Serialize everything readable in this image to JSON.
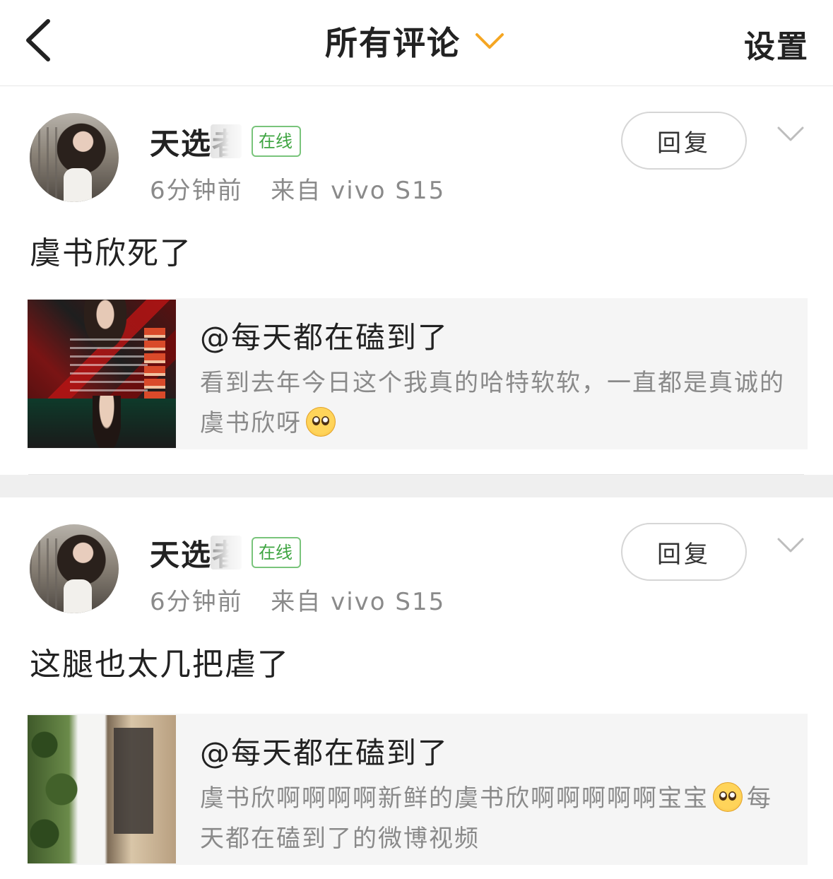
{
  "header": {
    "title": "所有评论",
    "settings_label": "设置"
  },
  "comments": [
    {
      "username": "天选者",
      "online_badge": "在线",
      "time": "6分钟前",
      "source": "来自 vivo S15",
      "reply_label": "回复",
      "text": "虞书欣死了",
      "quote": {
        "user": "@每天都在磕到了",
        "line1": "看到去年今日这个我真的哈特软软，一直都是真诚的",
        "line2_before": "虞书欣呀",
        "line2_after": ""
      }
    },
    {
      "username": "天选者",
      "online_badge": "在线",
      "time": "6分钟前",
      "source": "来自 vivo S15",
      "reply_label": "回复",
      "text": "这腿也太几把虐了",
      "quote": {
        "user": "@每天都在磕到了",
        "line1_before": "虞书欣啊啊啊啊新鲜的虞书欣啊啊啊啊啊宝宝",
        "line1_after": "每",
        "line2": "天都在磕到了的微博视频"
      }
    }
  ],
  "icons": {
    "back": "chevron-left-icon",
    "title_dropdown": "chevron-down-icon",
    "comment_menu": "chevron-down-icon",
    "emoji": "pleading-face-emoji"
  },
  "colors": {
    "title_chevron": "#f5a623",
    "online_badge": "#3fa542",
    "meta_text": "#8a8a8a",
    "quote_bg": "#f5f5f5"
  }
}
